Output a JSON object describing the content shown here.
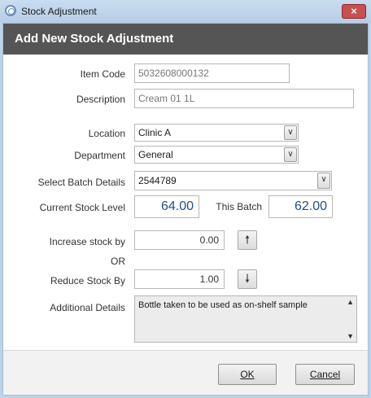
{
  "window": {
    "title": "Stock Adjustment",
    "close_glyph": "×"
  },
  "header": {
    "title": "Add New Stock Adjustment"
  },
  "item": {
    "item_code_label": "Item Code",
    "item_code": "5032608000132",
    "description_label": "Description",
    "description": "Cream 01 1L"
  },
  "location": {
    "label": "Location",
    "value": "Clinic A"
  },
  "department": {
    "label": "Department",
    "value": "General"
  },
  "batch": {
    "label": "Select Batch Details",
    "value": "2544789"
  },
  "stock": {
    "current_label": "Current Stock Level",
    "current_value": "64.00",
    "this_batch_label": "This Batch",
    "this_batch_value": "62.00"
  },
  "increase": {
    "label": "Increase stock by",
    "value": "0.00",
    "icon": "arrow-up-icon"
  },
  "or_label": "OR",
  "reduce": {
    "label": "Reduce Stock By",
    "value": "1.00",
    "icon": "arrow-down-icon"
  },
  "details": {
    "label": "Additional Details",
    "value": "Bottle taken to be used as on-shelf sample"
  },
  "buttons": {
    "ok": "OK",
    "cancel": "Cancel"
  },
  "colors": {
    "header_band": "#555555",
    "value_blue": "#1f4e8c",
    "close_red": "#c75050"
  }
}
